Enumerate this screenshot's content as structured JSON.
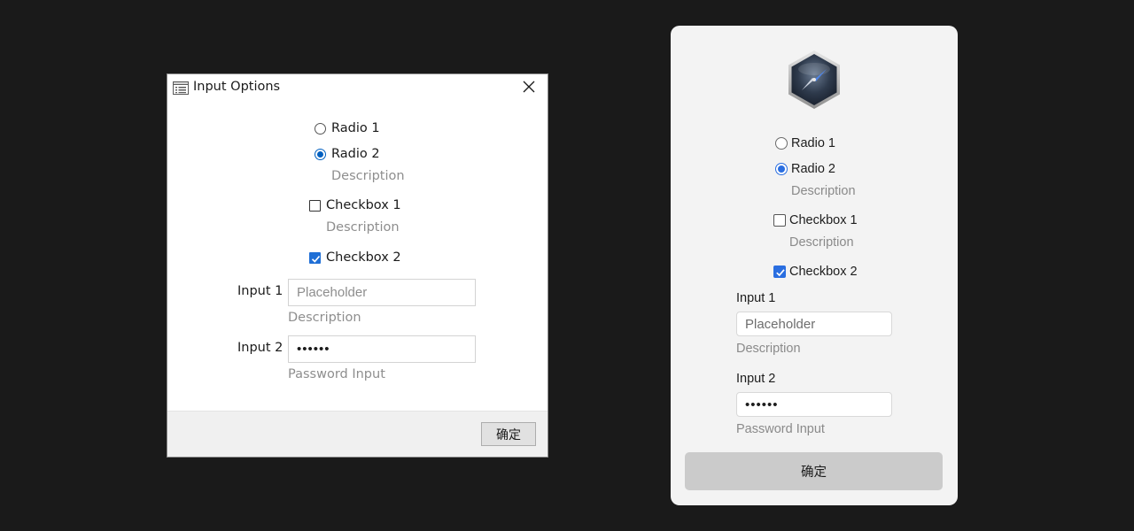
{
  "windows_dialog": {
    "title": "Input Options",
    "icon": "list-window-icon",
    "close_icon": "close-icon",
    "radio1": {
      "label": "Radio 1",
      "selected": false
    },
    "radio2": {
      "label": "Radio 2",
      "selected": true,
      "description": "Description"
    },
    "checkbox1": {
      "label": "Checkbox 1",
      "checked": false,
      "description": "Description"
    },
    "checkbox2": {
      "label": "Checkbox 2",
      "checked": true
    },
    "input1": {
      "label": "Input 1",
      "placeholder": "Placeholder",
      "value": "",
      "description": "Description"
    },
    "input2": {
      "label": "Input 2",
      "value": "••••••",
      "description": "Password Input"
    },
    "ok_label": "确定"
  },
  "mac_panel": {
    "app_icon": "compass-app-icon",
    "radio1": {
      "label": "Radio 1",
      "selected": false
    },
    "radio2": {
      "label": "Radio 2",
      "selected": true,
      "description": "Description"
    },
    "checkbox1": {
      "label": "Checkbox 1",
      "checked": false,
      "description": "Description"
    },
    "checkbox2": {
      "label": "Checkbox 2",
      "checked": true
    },
    "input1": {
      "label": "Input 1",
      "placeholder": "Placeholder",
      "value": "",
      "description": "Description"
    },
    "input2": {
      "label": "Input 2",
      "value": "••••••",
      "description": "Password Input"
    },
    "ok_label": "确定"
  },
  "colors": {
    "background": "#1a1a1a",
    "windows_accent": "#0060c0",
    "mac_accent": "#2a6ee0",
    "description_text": "#8e8e8e"
  }
}
